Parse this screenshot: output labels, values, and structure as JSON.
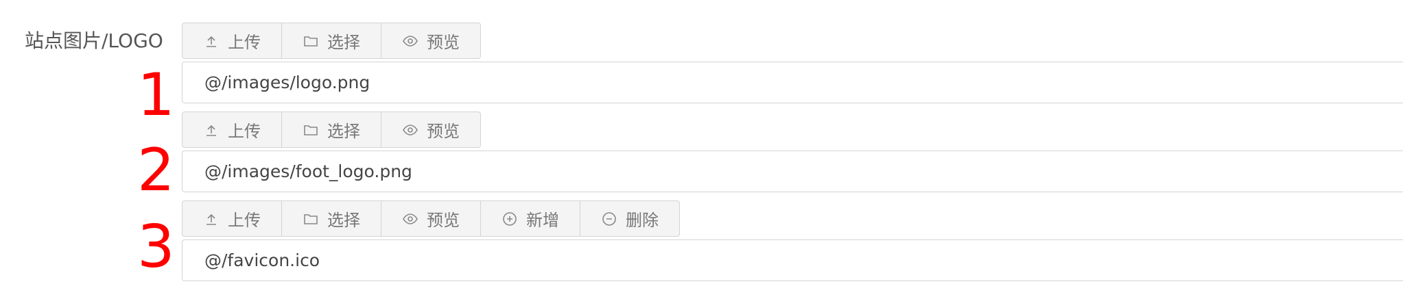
{
  "field": {
    "label": "站点图片/LOGO"
  },
  "toolbar": {
    "upload": "上传",
    "select": "选择",
    "preview": "预览",
    "add": "新增",
    "delete": "删除"
  },
  "annotations": [
    "1",
    "2",
    "3"
  ],
  "rows": [
    {
      "value": "@/images/logo.png"
    },
    {
      "value": "@/images/foot_logo.png"
    },
    {
      "value": "@/favicon.ico"
    }
  ],
  "colors": {
    "annotation": "#ff0000",
    "border": "#d3d3d3",
    "toolbar_bg": "#f4f4f4",
    "text": "#444444"
  }
}
